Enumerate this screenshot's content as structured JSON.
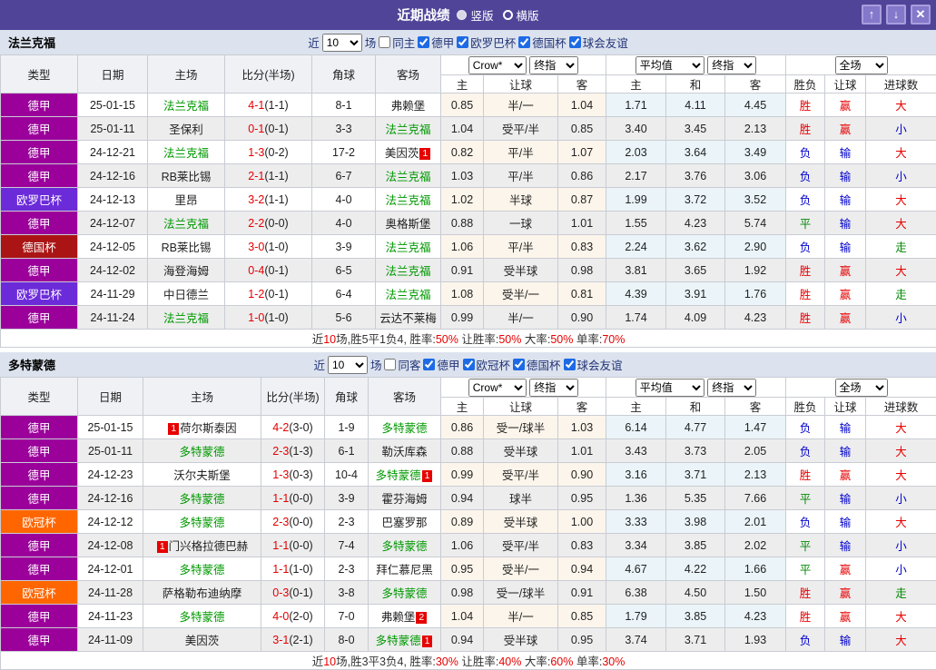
{
  "title_bar": {
    "title": "近期战绩",
    "view_options": [
      {
        "label": "竖版",
        "selected": true
      },
      {
        "label": "横版",
        "selected": false
      }
    ],
    "buttons": {
      "up": "↑",
      "down": "↓",
      "close": "✕"
    },
    "bg_color": "#504499"
  },
  "table": {
    "headers": [
      "类型",
      "日期",
      "主场",
      "比分(半场)",
      "角球",
      "客场"
    ],
    "odds_source": "Crow*",
    "final_label": "终指",
    "avg_label": "平均值",
    "scope_label": "全场",
    "sub_headers": [
      "主",
      "让球",
      "客",
      "主",
      "和",
      "客",
      "胜负",
      "让球",
      "进球数"
    ]
  },
  "type_colors": {
    "德甲": "#9b009b",
    "欧罗巴杯": "#6c2bd9",
    "德国杯": "#aa1414",
    "欧冠杯": "#ff6600"
  },
  "result_colors": {
    "胜": "#e60000",
    "赢": "#e60000",
    "大": "#e60000",
    "负": "#0000cc",
    "输": "#0000cc",
    "小": "#0000cc",
    "平": "#008800",
    "走": "#008800"
  },
  "sections": [
    {
      "team": "法兰克福",
      "filter": {
        "near": "近",
        "count": "10",
        "games": "场",
        "same": "同主",
        "leagues": [
          "德甲",
          "欧罗巴杯",
          "德国杯",
          "球会友谊"
        ]
      },
      "rows": [
        {
          "type": "德甲",
          "date": "25-01-15",
          "home": "法兰克福",
          "home_focal": true,
          "home_badge": "",
          "score": "4-1",
          "half": "(1-1)",
          "corner": "8-1",
          "away": "弗赖堡",
          "away_focal": false,
          "away_badge": "",
          "odds": [
            "0.85",
            "半/一",
            "1.04"
          ],
          "avg": [
            "1.71",
            "4.11",
            "4.45"
          ],
          "results": [
            "胜",
            "赢",
            "大"
          ]
        },
        {
          "type": "德甲",
          "date": "25-01-11",
          "home": "圣保利",
          "home_focal": false,
          "home_badge": "",
          "score": "0-1",
          "half": "(0-1)",
          "corner": "3-3",
          "away": "法兰克福",
          "away_focal": true,
          "away_badge": "",
          "odds": [
            "1.04",
            "受平/半",
            "0.85"
          ],
          "avg": [
            "3.40",
            "3.45",
            "2.13"
          ],
          "results": [
            "胜",
            "赢",
            "小"
          ]
        },
        {
          "type": "德甲",
          "date": "24-12-21",
          "home": "法兰克福",
          "home_focal": true,
          "home_badge": "",
          "score": "1-3",
          "half": "(0-2)",
          "corner": "17-2",
          "away": "美因茨",
          "away_focal": false,
          "away_badge": "1",
          "odds": [
            "0.82",
            "平/半",
            "1.07"
          ],
          "avg": [
            "2.03",
            "3.64",
            "3.49"
          ],
          "results": [
            "负",
            "输",
            "大"
          ]
        },
        {
          "type": "德甲",
          "date": "24-12-16",
          "home": "RB莱比锡",
          "home_focal": false,
          "home_badge": "",
          "score": "2-1",
          "half": "(1-1)",
          "corner": "6-7",
          "away": "法兰克福",
          "away_focal": true,
          "away_badge": "",
          "odds": [
            "1.03",
            "平/半",
            "0.86"
          ],
          "avg": [
            "2.17",
            "3.76",
            "3.06"
          ],
          "results": [
            "负",
            "输",
            "小"
          ]
        },
        {
          "type": "欧罗巴杯",
          "date": "24-12-13",
          "home": "里昂",
          "home_focal": false,
          "home_badge": "",
          "score": "3-2",
          "half": "(1-1)",
          "corner": "4-0",
          "away": "法兰克福",
          "away_focal": true,
          "away_badge": "",
          "odds": [
            "1.02",
            "半球",
            "0.87"
          ],
          "avg": [
            "1.99",
            "3.72",
            "3.52"
          ],
          "results": [
            "负",
            "输",
            "大"
          ]
        },
        {
          "type": "德甲",
          "date": "24-12-07",
          "home": "法兰克福",
          "home_focal": true,
          "home_badge": "",
          "score": "2-2",
          "half": "(0-0)",
          "corner": "4-0",
          "away": "奥格斯堡",
          "away_focal": false,
          "away_badge": "",
          "odds": [
            "0.88",
            "一球",
            "1.01"
          ],
          "avg": [
            "1.55",
            "4.23",
            "5.74"
          ],
          "results": [
            "平",
            "输",
            "大"
          ]
        },
        {
          "type": "德国杯",
          "date": "24-12-05",
          "home": "RB莱比锡",
          "home_focal": false,
          "home_badge": "",
          "score": "3-0",
          "half": "(1-0)",
          "corner": "3-9",
          "away": "法兰克福",
          "away_focal": true,
          "away_badge": "",
          "odds": [
            "1.06",
            "平/半",
            "0.83"
          ],
          "avg": [
            "2.24",
            "3.62",
            "2.90"
          ],
          "results": [
            "负",
            "输",
            "走"
          ]
        },
        {
          "type": "德甲",
          "date": "24-12-02",
          "home": "海登海姆",
          "home_focal": false,
          "home_badge": "",
          "score": "0-4",
          "half": "(0-1)",
          "corner": "6-5",
          "away": "法兰克福",
          "away_focal": true,
          "away_badge": "",
          "odds": [
            "0.91",
            "受半球",
            "0.98"
          ],
          "avg": [
            "3.81",
            "3.65",
            "1.92"
          ],
          "results": [
            "胜",
            "赢",
            "大"
          ]
        },
        {
          "type": "欧罗巴杯",
          "date": "24-11-29",
          "home": "中日德兰",
          "home_focal": false,
          "home_badge": "",
          "score": "1-2",
          "half": "(0-1)",
          "corner": "6-4",
          "away": "法兰克福",
          "away_focal": true,
          "away_badge": "",
          "odds": [
            "1.08",
            "受半/一",
            "0.81"
          ],
          "avg": [
            "4.39",
            "3.91",
            "1.76"
          ],
          "results": [
            "胜",
            "赢",
            "走"
          ]
        },
        {
          "type": "德甲",
          "date": "24-11-24",
          "home": "法兰克福",
          "home_focal": true,
          "home_badge": "",
          "score": "1-0",
          "half": "(1-0)",
          "corner": "5-6",
          "away": "云达不莱梅",
          "away_focal": false,
          "away_badge": "",
          "odds": [
            "0.99",
            "半/一",
            "0.90"
          ],
          "avg": [
            "1.74",
            "4.09",
            "4.23"
          ],
          "results": [
            "胜",
            "赢",
            "小"
          ]
        }
      ],
      "summary": [
        [
          "近",
          false
        ],
        [
          "10",
          true
        ],
        [
          "场,胜5平1负4, 胜率:",
          false
        ],
        [
          "50%",
          true
        ],
        [
          " 让胜率:",
          false
        ],
        [
          "50%",
          true
        ],
        [
          " 大率:",
          false
        ],
        [
          "50%",
          true
        ],
        [
          " 单率:",
          false
        ],
        [
          "70%",
          true
        ]
      ]
    },
    {
      "team": "多特蒙德",
      "filter": {
        "near": "近",
        "count": "10",
        "games": "场",
        "same": "同客",
        "leagues": [
          "德甲",
          "欧冠杯",
          "德国杯",
          "球会友谊"
        ]
      },
      "rows": [
        {
          "type": "德甲",
          "date": "25-01-15",
          "home": "荷尔斯泰因",
          "home_focal": false,
          "home_badge": "1",
          "score": "4-2",
          "half": "(3-0)",
          "corner": "1-9",
          "away": "多特蒙德",
          "away_focal": true,
          "away_badge": "",
          "odds": [
            "0.86",
            "受一/球半",
            "1.03"
          ],
          "avg": [
            "6.14",
            "4.77",
            "1.47"
          ],
          "results": [
            "负",
            "输",
            "大"
          ]
        },
        {
          "type": "德甲",
          "date": "25-01-11",
          "home": "多特蒙德",
          "home_focal": true,
          "home_badge": "",
          "score": "2-3",
          "half": "(1-3)",
          "corner": "6-1",
          "away": "勒沃库森",
          "away_focal": false,
          "away_badge": "",
          "odds": [
            "0.88",
            "受半球",
            "1.01"
          ],
          "avg": [
            "3.43",
            "3.73",
            "2.05"
          ],
          "results": [
            "负",
            "输",
            "大"
          ]
        },
        {
          "type": "德甲",
          "date": "24-12-23",
          "home": "沃尔夫斯堡",
          "home_focal": false,
          "home_badge": "",
          "score": "1-3",
          "half": "(0-3)",
          "corner": "10-4",
          "away": "多特蒙德",
          "away_focal": true,
          "away_badge": "1",
          "odds": [
            "0.99",
            "受平/半",
            "0.90"
          ],
          "avg": [
            "3.16",
            "3.71",
            "2.13"
          ],
          "results": [
            "胜",
            "赢",
            "大"
          ]
        },
        {
          "type": "德甲",
          "date": "24-12-16",
          "home": "多特蒙德",
          "home_focal": true,
          "home_badge": "",
          "score": "1-1",
          "half": "(0-0)",
          "corner": "3-9",
          "away": "霍芬海姆",
          "away_focal": false,
          "away_badge": "",
          "odds": [
            "0.94",
            "球半",
            "0.95"
          ],
          "avg": [
            "1.36",
            "5.35",
            "7.66"
          ],
          "results": [
            "平",
            "输",
            "小"
          ]
        },
        {
          "type": "欧冠杯",
          "date": "24-12-12",
          "home": "多特蒙德",
          "home_focal": true,
          "home_badge": "",
          "score": "2-3",
          "half": "(0-0)",
          "corner": "2-3",
          "away": "巴塞罗那",
          "away_focal": false,
          "away_badge": "",
          "odds": [
            "0.89",
            "受半球",
            "1.00"
          ],
          "avg": [
            "3.33",
            "3.98",
            "2.01"
          ],
          "results": [
            "负",
            "输",
            "大"
          ]
        },
        {
          "type": "德甲",
          "date": "24-12-08",
          "home": "门兴格拉德巴赫",
          "home_focal": false,
          "home_badge": "1",
          "score": "1-1",
          "half": "(0-0)",
          "corner": "7-4",
          "away": "多特蒙德",
          "away_focal": true,
          "away_badge": "",
          "odds": [
            "1.06",
            "受平/半",
            "0.83"
          ],
          "avg": [
            "3.34",
            "3.85",
            "2.02"
          ],
          "results": [
            "平",
            "输",
            "小"
          ]
        },
        {
          "type": "德甲",
          "date": "24-12-01",
          "home": "多特蒙德",
          "home_focal": true,
          "home_badge": "",
          "score": "1-1",
          "half": "(1-0)",
          "corner": "2-3",
          "away": "拜仁慕尼黑",
          "away_focal": false,
          "away_badge": "",
          "odds": [
            "0.95",
            "受半/一",
            "0.94"
          ],
          "avg": [
            "4.67",
            "4.22",
            "1.66"
          ],
          "results": [
            "平",
            "赢",
            "小"
          ]
        },
        {
          "type": "欧冠杯",
          "date": "24-11-28",
          "home": "萨格勒布迪纳摩",
          "home_focal": false,
          "home_badge": "",
          "score": "0-3",
          "half": "(0-1)",
          "corner": "3-8",
          "away": "多特蒙德",
          "away_focal": true,
          "away_badge": "",
          "odds": [
            "0.98",
            "受一/球半",
            "0.91"
          ],
          "avg": [
            "6.38",
            "4.50",
            "1.50"
          ],
          "results": [
            "胜",
            "赢",
            "走"
          ]
        },
        {
          "type": "德甲",
          "date": "24-11-23",
          "home": "多特蒙德",
          "home_focal": true,
          "home_badge": "",
          "score": "4-0",
          "half": "(2-0)",
          "corner": "7-0",
          "away": "弗赖堡",
          "away_focal": false,
          "away_badge": "2",
          "odds": [
            "1.04",
            "半/一",
            "0.85"
          ],
          "avg": [
            "1.79",
            "3.85",
            "4.23"
          ],
          "results": [
            "胜",
            "赢",
            "大"
          ]
        },
        {
          "type": "德甲",
          "date": "24-11-09",
          "home": "美因茨",
          "home_focal": false,
          "home_badge": "",
          "score": "3-1",
          "half": "(2-1)",
          "corner": "8-0",
          "away": "多特蒙德",
          "away_focal": true,
          "away_badge": "1",
          "odds": [
            "0.94",
            "受半球",
            "0.95"
          ],
          "avg": [
            "3.74",
            "3.71",
            "1.93"
          ],
          "results": [
            "负",
            "输",
            "大"
          ]
        }
      ],
      "summary": [
        [
          "近",
          false
        ],
        [
          "10",
          true
        ],
        [
          "场,胜3平3负4, 胜率:",
          false
        ],
        [
          "30%",
          true
        ],
        [
          " 让胜率:",
          false
        ],
        [
          "40%",
          true
        ],
        [
          " 大率:",
          false
        ],
        [
          "60%",
          true
        ],
        [
          " 单率:",
          false
        ],
        [
          "30%",
          true
        ]
      ]
    }
  ]
}
